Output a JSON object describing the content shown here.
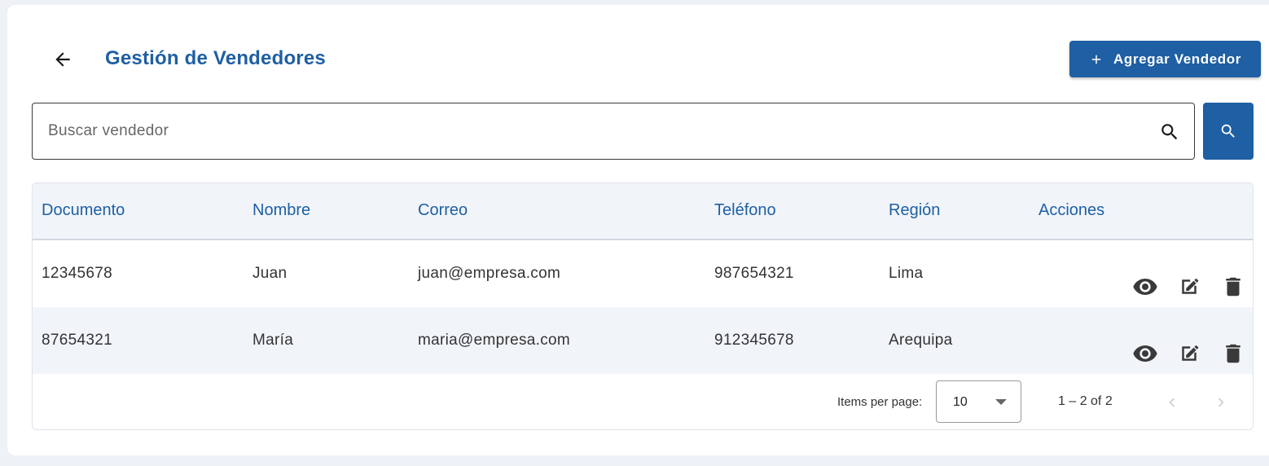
{
  "header": {
    "back_icon": "arrow-left-icon",
    "title": "Gestión de Vendedores",
    "add_button": {
      "icon": "plus-icon",
      "label": "Agregar Vendedor"
    }
  },
  "search": {
    "placeholder": "Buscar vendedor",
    "value": "",
    "inner_icon": "search-icon",
    "button_icon": "search-icon"
  },
  "table": {
    "columns": [
      "Documento",
      "Nombre",
      "Correo",
      "Teléfono",
      "Región",
      "Acciones"
    ],
    "rows": [
      {
        "documento": "12345678",
        "nombre": "Juan",
        "correo": "juan@empresa.com",
        "telefono": "987654321",
        "region": "Lima"
      },
      {
        "documento": "87654321",
        "nombre": "María",
        "correo": "maria@empresa.com",
        "telefono": "912345678",
        "region": "Arequipa"
      }
    ],
    "action_icons": [
      "eye-icon",
      "edit-icon",
      "trash-icon"
    ]
  },
  "paginator": {
    "items_per_page_label": "Items per page:",
    "items_per_page_value": "10",
    "range_label": "1 – 2 of 2",
    "prev_icon": "chevron-left-icon",
    "next_icon": "chevron-right-icon",
    "prev_disabled": true,
    "next_disabled": true
  },
  "colors": {
    "primary": "#1f5fa3",
    "header_bg": "#f1f5fa",
    "page_bg": "#eef1f6",
    "icon_dark": "#3a3a3a"
  }
}
